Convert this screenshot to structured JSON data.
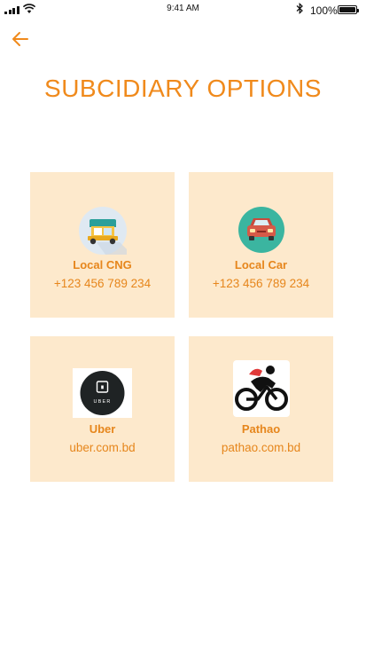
{
  "status_bar": {
    "time": "9:41 AM",
    "battery_percent": "100%"
  },
  "header": {
    "back_icon": "arrow-left-icon",
    "title": "SUBCIDIARY OPTIONS"
  },
  "options": [
    {
      "name": "Local CNG",
      "detail": "+123 456 789 234",
      "icon": "cng-rickshaw-icon"
    },
    {
      "name": "Local Car",
      "detail": "+123 456 789 234",
      "icon": "car-icon"
    },
    {
      "name": "Uber",
      "detail": "uber.com.bd",
      "icon": "uber-logo",
      "logo_text": "UBER"
    },
    {
      "name": "Pathao",
      "detail": "pathao.com.bd",
      "icon": "pathao-logo"
    }
  ],
  "colors": {
    "accent": "#f08a1c",
    "card_background": "#fde9cc"
  }
}
